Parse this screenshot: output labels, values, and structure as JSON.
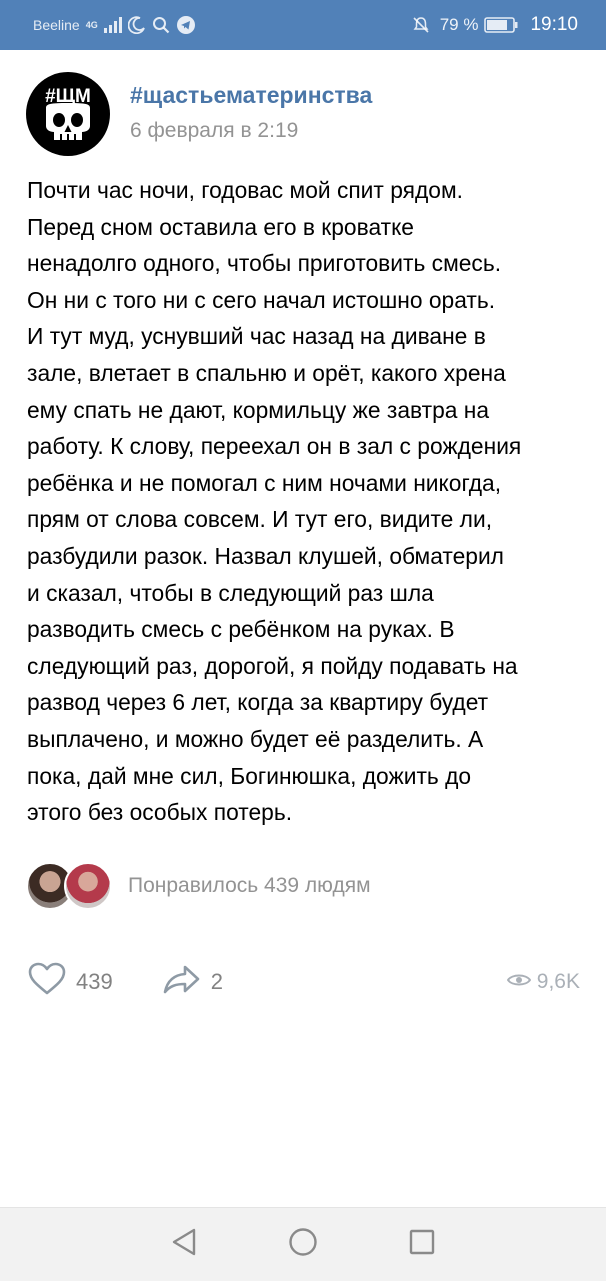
{
  "status_bar": {
    "carrier": "Beeline",
    "network": "4G",
    "battery_percent": "79 %",
    "time": "19:10",
    "icons": [
      "signal-icon",
      "moon-icon",
      "search-icon",
      "telegram-icon",
      "mute-icon",
      "battery-icon"
    ]
  },
  "post": {
    "group_name": "#щастьематеринства",
    "avatar_text": "#ЩМ",
    "date": "6 февраля в 2:19",
    "body_lines": [
      "Почти час ночи, годовас мой спит рядом.",
      "Перед сном оставила его в кроватке",
      "ненадолго одного, чтобы приготовить смесь.",
      "Он ни с того ни с сего начал истошно орать.",
      "И тут муд, уснувший час назад на диване в",
      "зале, влетает в спальню и орёт, какого хрена",
      "ему спать не дают, кормильцу же завтра на",
      "работу. К слову, переехал он в зал с рождения",
      "ребёнка и не помогал с ним ночами никогда,",
      "прям от слова совсем. И тут его, видите ли,",
      "разбудили разок. Назвал клушей, обматерил",
      "и сказал, чтобы в следующий раз шла",
      "разводить смесь с ребёнком на руках. В",
      "следующий раз, дорогой, я пойду подавать на",
      "развод через 6 лет, когда за квартиру будет",
      "выплачено, и можно будет её разделить. А",
      "пока, дай мне сил, Богинюшка, дожить до",
      "этого без особых потерь."
    ],
    "likes_summary": "Понравилось 439 людям",
    "like_count": "439",
    "share_count": "2",
    "view_count": "9,6K"
  },
  "colors": {
    "status_bar": "#5181b8",
    "group_name": "#4a76a8",
    "secondary_text": "#939393",
    "action_icon": "#8e9aa5"
  }
}
